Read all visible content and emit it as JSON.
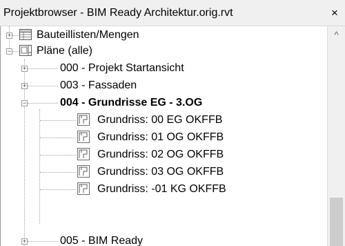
{
  "window": {
    "title": "Projektbrowser - BIM Ready Architektur.orig.rvt",
    "close_label": "×"
  },
  "tree": {
    "schedules": {
      "label": "Bauteillisten/Mengen",
      "icon": "schedule-table-icon",
      "expander": "+"
    },
    "sheets": {
      "label": "Pläne (alle)",
      "icon": "sheet-set-icon",
      "expander": "−"
    },
    "sheet_groups": [
      {
        "label": "000 - Projekt Startansicht",
        "expander": "+"
      },
      {
        "label": "003 - Fassaden",
        "expander": "+"
      },
      {
        "label": "004 - Grundrisse EG - 3.OG",
        "expander": "−",
        "selected": true
      },
      {
        "label": "005 - BIM Ready",
        "expander": "+"
      }
    ],
    "views": [
      {
        "label": "Grundriss: 00 EG OKFFB",
        "icon": "floor-plan-view-icon"
      },
      {
        "label": "Grundriss: 01 OG OKFFB",
        "icon": "floor-plan-view-icon"
      },
      {
        "label": "Grundriss: 02 OG OKFFB",
        "icon": "floor-plan-view-icon"
      },
      {
        "label": "Grundriss: 03 OG OKFFB",
        "icon": "floor-plan-view-icon"
      },
      {
        "label": "Grundriss: -01 KG OKFFB",
        "icon": "floor-plan-view-icon"
      }
    ]
  },
  "scrollbar": {
    "up_arrow": "^"
  }
}
